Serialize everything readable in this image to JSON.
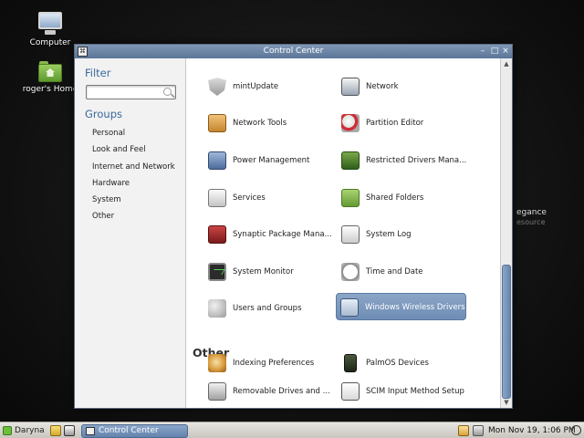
{
  "desktop": {
    "icons": [
      {
        "label": "Computer",
        "icon": "computer-icon"
      },
      {
        "label": "roger's Home",
        "icon": "home-folder-icon"
      }
    ],
    "background_text": {
      "title": "egance",
      "subtitle": "esource"
    }
  },
  "window": {
    "title": "Control Center",
    "controls": {
      "minimize": "–",
      "maximize": "□",
      "close": "×"
    }
  },
  "sidebar": {
    "filter_heading": "Filter",
    "filter_value": "",
    "groups_heading": "Groups",
    "groups": [
      {
        "label": "Personal"
      },
      {
        "label": "Look and Feel"
      },
      {
        "label": "Internet and Network"
      },
      {
        "label": "Hardware"
      },
      {
        "label": "System"
      },
      {
        "label": "Other"
      }
    ]
  },
  "main": {
    "items": [
      {
        "label": "mintUpdate",
        "icon": "shield-icon"
      },
      {
        "label": "Network",
        "icon": "network-icon"
      },
      {
        "label": "Network Tools",
        "icon": "network-tools-icon"
      },
      {
        "label": "Partition Editor",
        "icon": "partition-editor-icon"
      },
      {
        "label": "Power Management",
        "icon": "power-management-icon"
      },
      {
        "label": "Restricted Drivers Mana...",
        "icon": "restricted-drivers-icon"
      },
      {
        "label": "Services",
        "icon": "services-icon"
      },
      {
        "label": "Shared Folders",
        "icon": "shared-folders-icon"
      },
      {
        "label": "Synaptic Package Mana...",
        "icon": "synaptic-icon"
      },
      {
        "label": "System Log",
        "icon": "system-log-icon"
      },
      {
        "label": "System Monitor",
        "icon": "system-monitor-icon"
      },
      {
        "label": "Time and Date",
        "icon": "time-date-icon"
      },
      {
        "label": "Users and Groups",
        "icon": "users-groups-icon"
      },
      {
        "label": "Windows Wireless Drivers",
        "icon": "wireless-drivers-icon",
        "selected": true
      }
    ],
    "other_heading": "Other",
    "other_items": [
      {
        "label": "Indexing Preferences",
        "icon": "indexing-icon"
      },
      {
        "label": "PalmOS Devices",
        "icon": "palmos-icon"
      },
      {
        "label": "Removable Drives and ...",
        "icon": "removable-drives-icon"
      },
      {
        "label": "SCIM Input Method Setup",
        "icon": "scim-icon"
      }
    ]
  },
  "taskbar": {
    "menu_label": "Daryna",
    "task_label": "Control Center",
    "clock": "Mon Nov 19,  1:06 PM"
  }
}
